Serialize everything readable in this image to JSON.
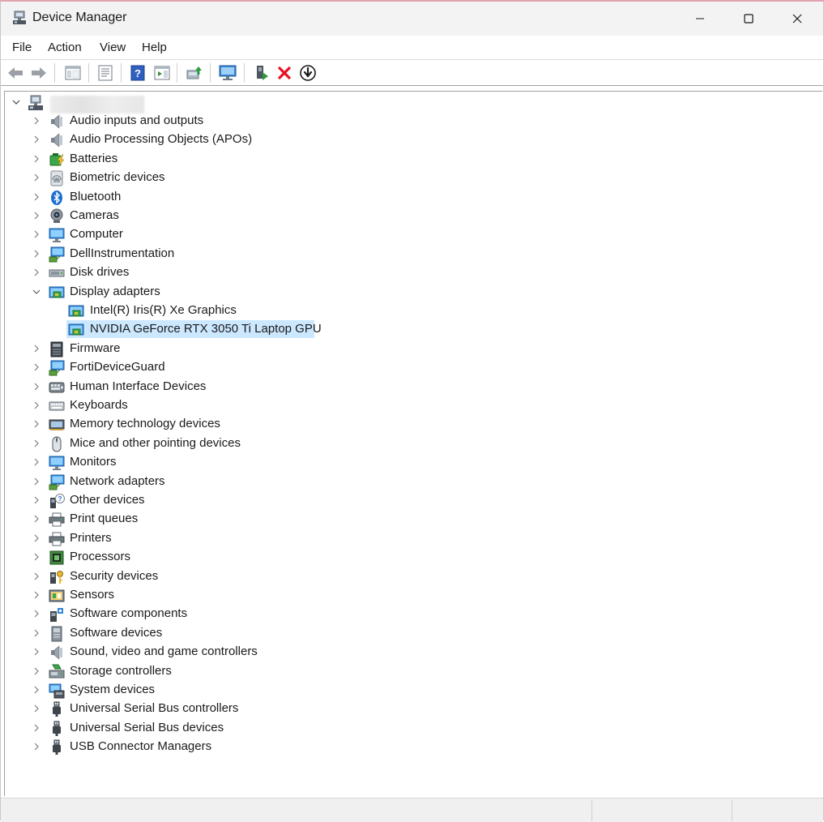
{
  "window": {
    "title": "Device Manager"
  },
  "menu": [
    {
      "label": "File"
    },
    {
      "label": "Action"
    },
    {
      "label": "View"
    },
    {
      "label": "Help"
    }
  ],
  "toolbar": {
    "buttons": [
      "back-icon",
      "forward-icon",
      "show-hide-console-tree-icon",
      "properties-icon",
      "help-icon",
      "action-pane-icon",
      "update-driver-icon",
      "scan-hardware-icon",
      "enable-device-icon",
      "uninstall-device-icon",
      "disable-device-icon"
    ]
  },
  "tree": {
    "root": {
      "label": "",
      "icon": "computer-root-icon",
      "expanded": true
    },
    "categories": [
      {
        "label": "Audio inputs and outputs",
        "icon": "speaker-icon"
      },
      {
        "label": "Audio Processing Objects (APOs)",
        "icon": "speaker-icon"
      },
      {
        "label": "Batteries",
        "icon": "battery-icon"
      },
      {
        "label": "Biometric devices",
        "icon": "fingerprint-icon"
      },
      {
        "label": "Bluetooth",
        "icon": "bluetooth-icon"
      },
      {
        "label": "Cameras",
        "icon": "camera-icon"
      },
      {
        "label": "Computer",
        "icon": "monitor-icon"
      },
      {
        "label": "DellInstrumentation",
        "icon": "network-monitor-icon"
      },
      {
        "label": "Disk drives",
        "icon": "disk-drive-icon"
      },
      {
        "label": "Display adapters",
        "icon": "display-adapter-icon",
        "expanded": true
      },
      {
        "label": "Intel(R) Iris(R) Xe Graphics",
        "icon": "display-adapter-icon",
        "child": true
      },
      {
        "label": "NVIDIA GeForce RTX 3050 Ti Laptop GPU",
        "icon": "display-adapter-icon",
        "child": true,
        "selected": true
      },
      {
        "label": "Firmware",
        "icon": "firmware-icon"
      },
      {
        "label": "FortiDeviceGuard",
        "icon": "network-monitor-icon"
      },
      {
        "label": "Human Interface Devices",
        "icon": "hid-icon"
      },
      {
        "label": "Keyboards",
        "icon": "keyboard-icon"
      },
      {
        "label": "Memory technology devices",
        "icon": "memory-icon"
      },
      {
        "label": "Mice and other pointing devices",
        "icon": "mouse-icon"
      },
      {
        "label": "Monitors",
        "icon": "monitor-icon"
      },
      {
        "label": "Network adapters",
        "icon": "network-monitor-icon"
      },
      {
        "label": "Other devices",
        "icon": "unknown-device-icon"
      },
      {
        "label": "Print queues",
        "icon": "printer-icon"
      },
      {
        "label": "Printers",
        "icon": "printer-icon"
      },
      {
        "label": "Processors",
        "icon": "processor-icon"
      },
      {
        "label": "Security devices",
        "icon": "security-key-icon"
      },
      {
        "label": "Sensors",
        "icon": "sensor-icon"
      },
      {
        "label": "Software components",
        "icon": "software-component-icon"
      },
      {
        "label": "Software devices",
        "icon": "software-device-icon"
      },
      {
        "label": "Sound, video and game controllers",
        "icon": "speaker-icon"
      },
      {
        "label": "Storage controllers",
        "icon": "storage-controller-icon"
      },
      {
        "label": "System devices",
        "icon": "system-device-icon"
      },
      {
        "label": "Universal Serial Bus controllers",
        "icon": "usb-icon"
      },
      {
        "label": "Universal Serial Bus devices",
        "icon": "usb-icon"
      },
      {
        "label": "USB Connector Managers",
        "icon": "usb-icon"
      }
    ]
  },
  "colors": {
    "selection": "#cce8ff",
    "accent": "#2f7fd6",
    "error": "#e81123"
  }
}
